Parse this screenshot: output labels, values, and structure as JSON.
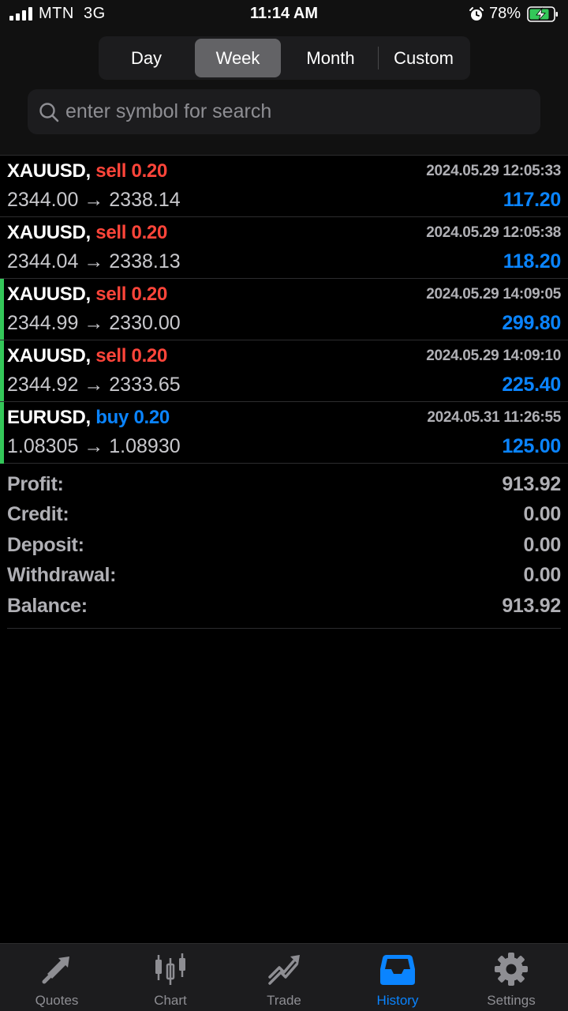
{
  "status": {
    "carrier": "MTN",
    "network": "3G",
    "time": "11:14 AM",
    "battery": "78%"
  },
  "period_tabs": [
    {
      "label": "Day",
      "active": false
    },
    {
      "label": "Week",
      "active": true
    },
    {
      "label": "Month",
      "active": false
    },
    {
      "label": "Custom",
      "active": false
    }
  ],
  "search": {
    "placeholder": "enter symbol for search"
  },
  "deals": [
    {
      "symbol": "XAUUSD,",
      "side": "sell",
      "volume": "0.20",
      "time": "2024.05.29 12:05:33",
      "prices": "2344.00 → 2338.14",
      "profit": "117.20",
      "marked": false
    },
    {
      "symbol": "XAUUSD,",
      "side": "sell",
      "volume": "0.20",
      "time": "2024.05.29 12:05:38",
      "prices": "2344.04 → 2338.13",
      "profit": "118.20",
      "marked": false
    },
    {
      "symbol": "XAUUSD,",
      "side": "sell",
      "volume": "0.20",
      "time": "2024.05.29 14:09:05",
      "prices": "2344.99 → 2330.00",
      "profit": "299.80",
      "marked": true
    },
    {
      "symbol": "XAUUSD,",
      "side": "sell",
      "volume": "0.20",
      "time": "2024.05.29 14:09:10",
      "prices": "2344.92 → 2333.65",
      "profit": "225.40",
      "marked": true
    },
    {
      "symbol": "EURUSD,",
      "side": "buy",
      "volume": "0.20",
      "time": "2024.05.31 11:26:55",
      "prices": "1.08305 → 1.08930",
      "profit": "125.00",
      "marked": true
    }
  ],
  "summary": [
    {
      "label": "Profit:",
      "value": "913.92"
    },
    {
      "label": "Credit:",
      "value": "0.00"
    },
    {
      "label": "Deposit:",
      "value": "0.00"
    },
    {
      "label": "Withdrawal:",
      "value": "0.00"
    },
    {
      "label": "Balance:",
      "value": "913.92"
    }
  ],
  "tabbar": [
    {
      "label": "Quotes",
      "icon": "quotes-icon",
      "active": false
    },
    {
      "label": "Chart",
      "icon": "chart-icon",
      "active": false
    },
    {
      "label": "Trade",
      "icon": "trade-icon",
      "active": false
    },
    {
      "label": "History",
      "icon": "history-icon",
      "active": true
    },
    {
      "label": "Settings",
      "icon": "settings-icon",
      "active": false
    }
  ],
  "colors": {
    "sell": "#ff453a",
    "buy": "#0a84ff",
    "profit": "#0a84ff",
    "marker": "#34c759",
    "active_tab": "#0a84ff"
  }
}
